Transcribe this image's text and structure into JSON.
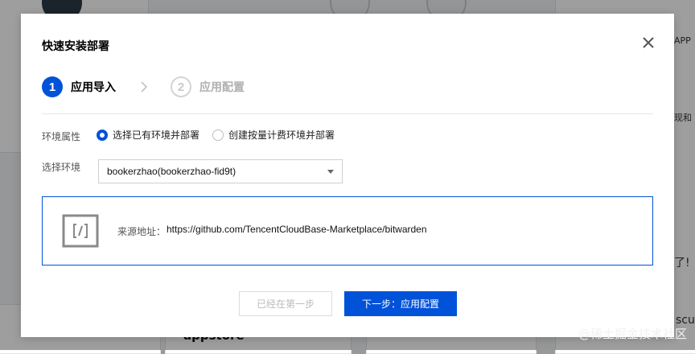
{
  "dialog": {
    "title": "快速安装部署",
    "steps": [
      {
        "number": "1",
        "label": "应用导入",
        "state": "active"
      },
      {
        "number": "2",
        "label": "应用配置",
        "state": "inactive"
      }
    ],
    "env_attribute": {
      "label": "环境属性",
      "options": [
        {
          "label": "选择已有环境并部署",
          "checked": true
        },
        {
          "label": "创建按量计费环境并部署",
          "checked": false
        }
      ]
    },
    "env_select": {
      "label": "选择环境",
      "value": "bookerzhao(bookerzhao-fid9t)"
    },
    "source": {
      "label": "来源地址：",
      "url": "https://github.com/TencentCloudBase-Marketplace/bitwarden"
    },
    "buttons": {
      "prev": "已经在第一步",
      "next": "下一步：应用配置"
    }
  },
  "background": {
    "card_title": "appstore",
    "side_text_1": "APP",
    "side_text_2": "了!",
    "side_text_3": "scu",
    "side_text_4": "现和"
  },
  "watermark": "@稀土掘金技术社区",
  "colors": {
    "primary": "#0052d9",
    "border": "#d0d0d0",
    "muted": "#b0b0b0"
  }
}
